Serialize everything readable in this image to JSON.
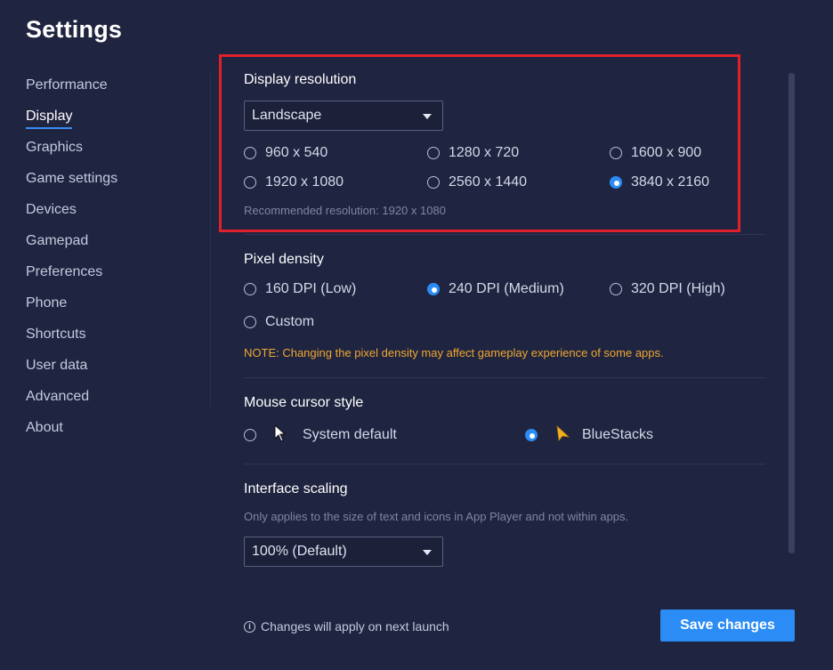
{
  "header": {
    "title": "Settings"
  },
  "sidebar": {
    "items": [
      {
        "label": "Performance"
      },
      {
        "label": "Display",
        "active": true
      },
      {
        "label": "Graphics"
      },
      {
        "label": "Game settings"
      },
      {
        "label": "Devices"
      },
      {
        "label": "Gamepad"
      },
      {
        "label": "Preferences"
      },
      {
        "label": "Phone"
      },
      {
        "label": "Shortcuts"
      },
      {
        "label": "User data"
      },
      {
        "label": "Advanced"
      },
      {
        "label": "About"
      }
    ]
  },
  "display_resolution": {
    "title": "Display resolution",
    "orientation": "Landscape",
    "options": [
      "960 x 540",
      "1280 x 720",
      "1600 x 900",
      "1920 x 1080",
      "2560 x 1440",
      "3840 x 2160"
    ],
    "selected": "3840 x 2160",
    "recommended": "Recommended resolution: 1920 x 1080"
  },
  "pixel_density": {
    "title": "Pixel density",
    "options": [
      "160 DPI (Low)",
      "240 DPI (Medium)",
      "320 DPI (High)",
      "Custom"
    ],
    "selected": "240 DPI (Medium)",
    "note": "NOTE: Changing the pixel density may affect gameplay experience of some apps."
  },
  "mouse_cursor": {
    "title": "Mouse cursor style",
    "options": [
      "System default",
      "BlueStacks"
    ],
    "selected": "BlueStacks"
  },
  "interface_scaling": {
    "title": "Interface scaling",
    "hint": "Only applies to the size of text and icons in App Player and not within apps.",
    "value": "100% (Default)"
  },
  "footer": {
    "note": "Changes will apply on next launch",
    "info_symbol": "i",
    "save_label": "Save changes"
  },
  "colors": {
    "background": "#1f2440",
    "accent": "#2b8cf5",
    "highlight": "#e0202a",
    "note": "#f0a830"
  }
}
